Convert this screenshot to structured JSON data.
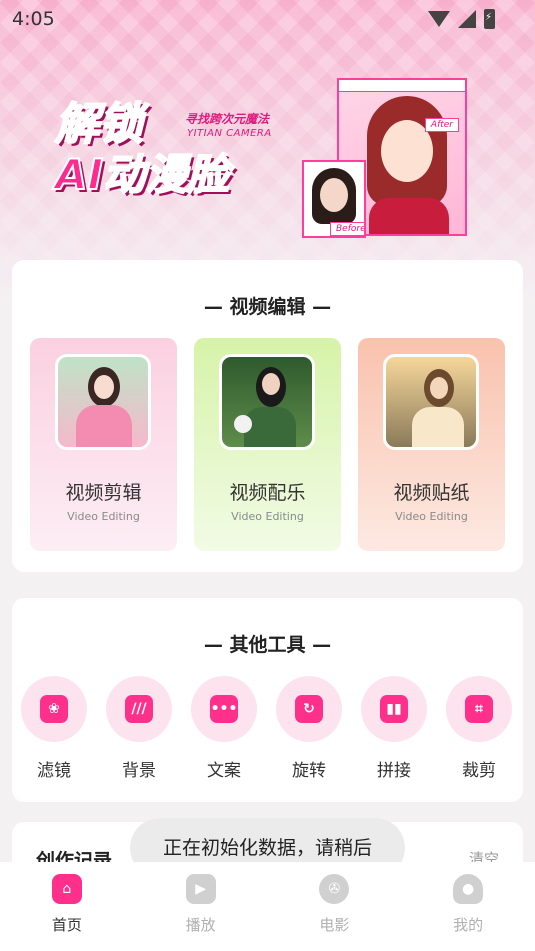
{
  "status_bar": {
    "time": "4:05"
  },
  "banner": {
    "title_line1": "解锁",
    "title_line2": "AI动漫脸",
    "subtitle": "寻找跨次元魔法",
    "subtitle_en": "YITIAN CAMERA",
    "after_tag": "After",
    "before_tag": "Before"
  },
  "video_section": {
    "title": "— 视频编辑 —",
    "tiles": [
      {
        "label": "视频剪辑",
        "sub": "Video Editing"
      },
      {
        "label": "视频配乐",
        "sub": "Video Editing"
      },
      {
        "label": "视频贴纸",
        "sub": "Video Editing"
      }
    ]
  },
  "tools_section": {
    "title": "— 其他工具 —",
    "tools": [
      {
        "label": "滤镜",
        "icon": "filter-icon"
      },
      {
        "label": "背景",
        "icon": "background-icon"
      },
      {
        "label": "文案",
        "icon": "text-icon"
      },
      {
        "label": "旋转",
        "icon": "rotate-icon"
      },
      {
        "label": "拼接",
        "icon": "splice-icon"
      },
      {
        "label": "裁剪",
        "icon": "crop-icon"
      }
    ]
  },
  "records": {
    "title": "创作记录",
    "clear": "清空"
  },
  "toast": "正在初始化数据，请稍后",
  "bottom_nav": [
    {
      "label": "首页",
      "icon": "home-icon"
    },
    {
      "label": "播放",
      "icon": "play-icon"
    },
    {
      "label": "电影",
      "icon": "film-icon"
    },
    {
      "label": "我的",
      "icon": "profile-icon"
    }
  ],
  "colors": {
    "accent": "#ff2f8c",
    "tile1": "#fbd9e6",
    "tile2": "#e2f7c6",
    "tile3": "#fbd6c6"
  }
}
